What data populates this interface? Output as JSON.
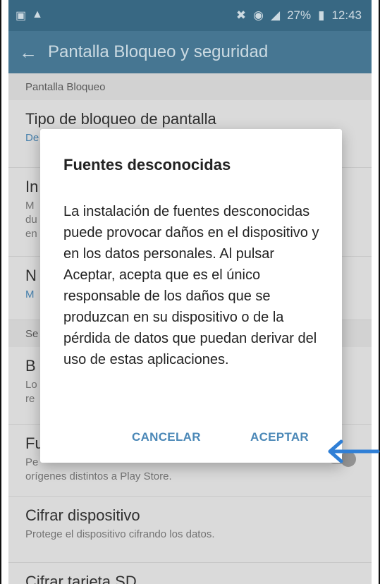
{
  "status_bar": {
    "left_icons": [
      "image-icon",
      "warning-icon"
    ],
    "battery": "27%",
    "time": "12:43"
  },
  "appbar": {
    "title": "Pantalla Bloqueo y seguridad"
  },
  "sections": {
    "lock_screen_header": "Pantalla Bloqueo",
    "security_header_partial": "Se"
  },
  "items": {
    "lock_type_title": "Tipo de bloqueo de pantalla",
    "lock_type_sub_partial": "De",
    "info_title_partial": "In",
    "info_sub_partial": [
      "M",
      "du",
      "en"
    ],
    "notif_title_partial": "N",
    "notif_sub_partial": "M",
    "b_title_partial": "B",
    "b_sub_partial": [
      "Lo",
      "re"
    ],
    "unknown_sources_title_partial": "Fu",
    "unknown_sources_sub_partial": "Pe",
    "unknown_sources_sub_line2": "orígenes distintos a Play Store.",
    "encrypt_title": "Cifrar dispositivo",
    "encrypt_sub": "Protege el dispositivo cifrando los datos.",
    "sd_title_partial": "Cifrar tarjeta SD"
  },
  "dialog": {
    "title": "Fuentes desconocidas",
    "body": "La instalación de fuentes desconocidas puede provocar daños en el dispositivo y en los datos personales. Al pulsar Aceptar, acepta que es el único responsable de los daños que se produzcan en su dispositivo o de la pérdida de datos que puedan derivar del uso de estas aplicaciones.",
    "cancel": "CANCELAR",
    "accept": "ACEPTAR"
  },
  "colors": {
    "status_bar": "#3c6e8b",
    "appbar": "#4a7d9a",
    "accent": "#4b88b7",
    "arrow": "#2f7fd6"
  }
}
